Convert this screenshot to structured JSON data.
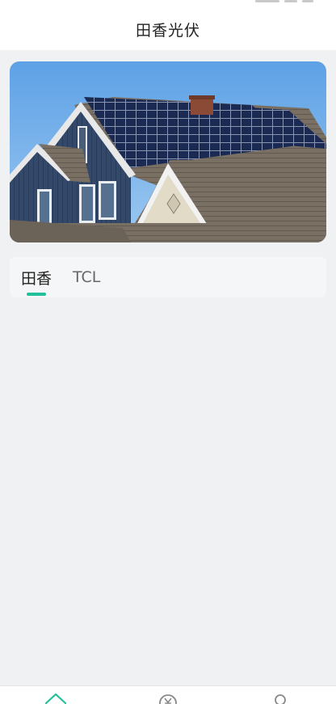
{
  "header": {
    "title": "田香光伏"
  },
  "banner": {
    "image": "house-with-solar-panels-photo"
  },
  "tabs": [
    {
      "label": "田香",
      "active": true
    },
    {
      "label": "TCL",
      "active": false
    }
  ],
  "bottom_nav": [
    {
      "icon": "home-icon",
      "active": true,
      "color": "#1fc09a"
    },
    {
      "icon": "yuan-icon",
      "active": false,
      "color": "#888888"
    },
    {
      "icon": "user-icon",
      "active": false,
      "color": "#888888"
    }
  ],
  "colors": {
    "accent": "#1fc09a",
    "background": "#f0f1f2"
  }
}
